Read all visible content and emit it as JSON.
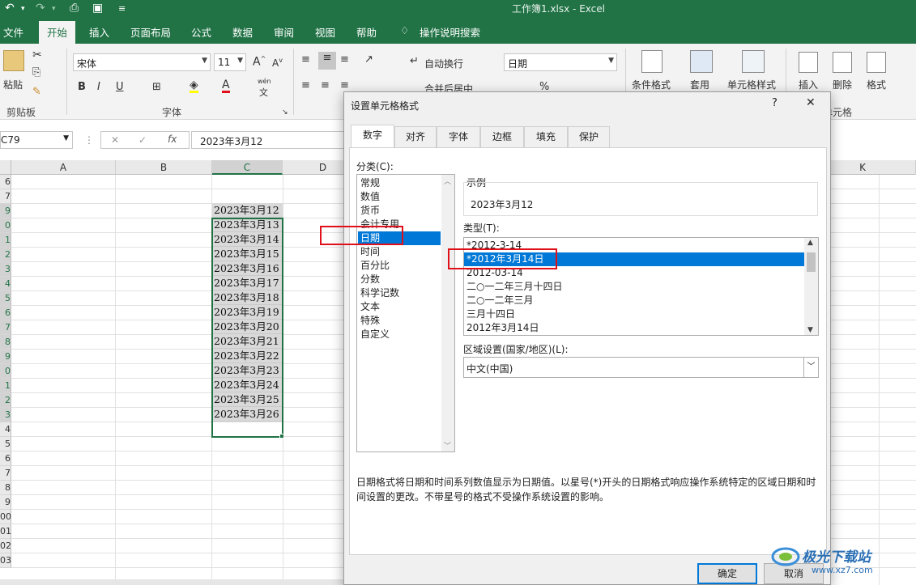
{
  "window": {
    "title": "工作簿1.xlsx  -  Excel"
  },
  "ribbon_tabs": [
    "文件",
    "开始",
    "插入",
    "页面布局",
    "公式",
    "数据",
    "审阅",
    "视图",
    "帮助",
    "操作说明搜索"
  ],
  "ribbon": {
    "clipboard_paste": "粘贴",
    "clipboard_group": "剪贴板",
    "font_name": "宋体",
    "font_size": "11",
    "font_group": "字体",
    "bold": "B",
    "italic": "I",
    "underline": "U",
    "wen_label": "wén",
    "wen_char": "文",
    "wrap_text": "自动换行",
    "merge_center": "合并后居中",
    "number_format": "日期",
    "conditional_format": "条件格式",
    "format_table": "套用",
    "cell_styles": "单元格样式",
    "insert": "插入",
    "delete": "删除",
    "format": "格式",
    "cells_group": "单元格",
    "percent": "%"
  },
  "formula_bar": {
    "name_box": "C79",
    "fx": "fx",
    "value": "2023年3月12"
  },
  "grid": {
    "columns": [
      "A",
      "B",
      "C",
      "D",
      "K"
    ],
    "rows": [
      "6",
      "7",
      "9",
      "0",
      "1",
      "2",
      "3",
      "4",
      "5",
      "6",
      "7",
      "8",
      "9",
      "0",
      "1",
      "2",
      "3",
      "4",
      "5",
      "6",
      "7",
      "8",
      "9",
      "00",
      "01",
      "02",
      "03"
    ],
    "cells": [
      "2023年3月12",
      "2023年3月13",
      "2023年3月14",
      "2023年3月15",
      "2023年3月16",
      "2023年3月17",
      "2023年3月18",
      "2023年3月19",
      "2023年3月20",
      "2023年3月21",
      "2023年3月22",
      "2023年3月23",
      "2023年3月24",
      "2023年3月25",
      "2023年3月26"
    ]
  },
  "dialog": {
    "title": "设置单元格格式",
    "help": "?",
    "close": "✕",
    "tabs": [
      "数字",
      "对齐",
      "字体",
      "边框",
      "填充",
      "保护"
    ],
    "category_label": "分类(C):",
    "categories": [
      "常规",
      "数值",
      "货币",
      "会计专用",
      "日期",
      "时间",
      "百分比",
      "分数",
      "科学记数",
      "文本",
      "特殊",
      "自定义"
    ],
    "selected_category": "日期",
    "sample_label": "示例",
    "sample_value": "2023年3月12",
    "type_label": "类型(T):",
    "types": [
      "*2012-3-14",
      "*2012年3月14日",
      "2012-03-14",
      "二○一二年三月十四日",
      "二○一二年三月",
      "三月十四日",
      "2012年3月14日"
    ],
    "selected_type": "*2012年3月14日",
    "locale_label": "区域设置(国家/地区)(L):",
    "locale_value": "中文(中国)",
    "description": "日期格式将日期和时间系列数值显示为日期值。以星号(*)开头的日期格式响应操作系统特定的区域日期和时间设置的更改。不带星号的格式不受操作系统设置的影响。",
    "ok": "确定",
    "cancel": "取消"
  },
  "watermark": {
    "brand": "极光下载站",
    "url": "www.xz7.com"
  },
  "colors": {
    "excel_green": "#217346",
    "selection_blue": "#0078d7",
    "highlight_red": "#e0101a"
  }
}
